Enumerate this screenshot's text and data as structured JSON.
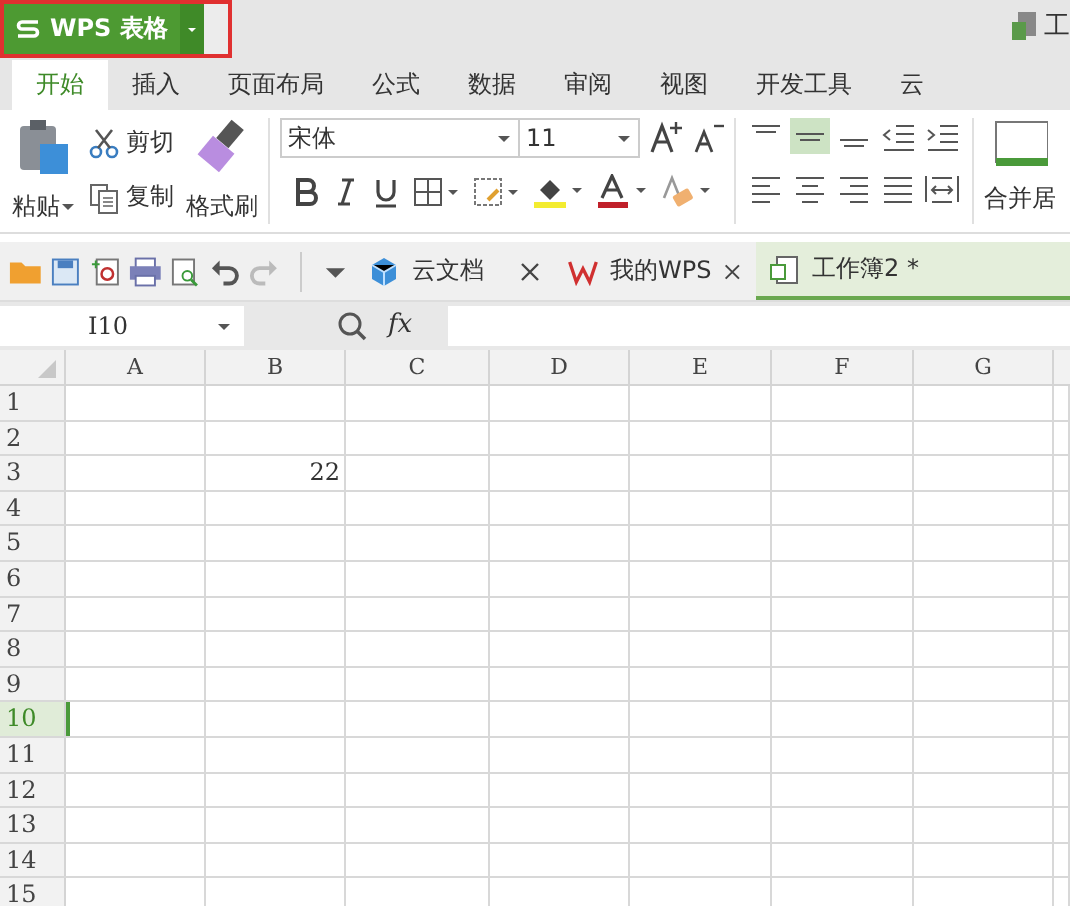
{
  "app_button": {
    "label": "WPS 表格"
  },
  "title_right": "工",
  "ribbon_tabs": [
    {
      "label": "开始",
      "selected": true
    },
    {
      "label": "插入",
      "selected": false
    },
    {
      "label": "页面布局",
      "selected": false
    },
    {
      "label": "公式",
      "selected": false
    },
    {
      "label": "数据",
      "selected": false
    },
    {
      "label": "审阅",
      "selected": false
    },
    {
      "label": "视图",
      "selected": false
    },
    {
      "label": "开发工具",
      "selected": false
    },
    {
      "label": "云",
      "selected": false
    }
  ],
  "clipboard": {
    "paste": "粘贴",
    "cut": "剪切",
    "copy": "复制",
    "format_painter": "格式刷"
  },
  "font": {
    "name": "宋体",
    "size": "11"
  },
  "align": [
    {
      "kind": "top",
      "selected": false
    },
    {
      "kind": "middle",
      "selected": true
    },
    {
      "kind": "bottom",
      "selected": false
    }
  ],
  "merge": {
    "label": "合并居"
  },
  "doc_tabs": [
    {
      "label": "云文档",
      "kind": "cloud",
      "selected": false
    },
    {
      "label": "我的WPS",
      "kind": "wps",
      "selected": false
    },
    {
      "label": "工作簿2 *",
      "kind": "sheet",
      "selected": true
    }
  ],
  "name_box": "I10",
  "fx": "fx",
  "sheet": {
    "columns": [
      "A",
      "B",
      "C",
      "D",
      "E",
      "F",
      "G"
    ],
    "rows": [
      {
        "label": "1",
        "selected": false
      },
      {
        "label": "2",
        "selected": false
      },
      {
        "label": "3",
        "selected": false,
        "cells": [
          null,
          "22"
        ]
      },
      {
        "label": "4",
        "selected": false
      },
      {
        "label": "5",
        "selected": false
      },
      {
        "label": "6",
        "selected": false
      },
      {
        "label": "7",
        "selected": false
      },
      {
        "label": "8",
        "selected": false
      },
      {
        "label": "9",
        "selected": false
      },
      {
        "label": "10",
        "selected": true
      },
      {
        "label": "11",
        "selected": false
      },
      {
        "label": "12",
        "selected": false
      },
      {
        "label": "13",
        "selected": false
      },
      {
        "label": "14",
        "selected": false
      },
      {
        "label": "15",
        "selected": false
      }
    ]
  }
}
